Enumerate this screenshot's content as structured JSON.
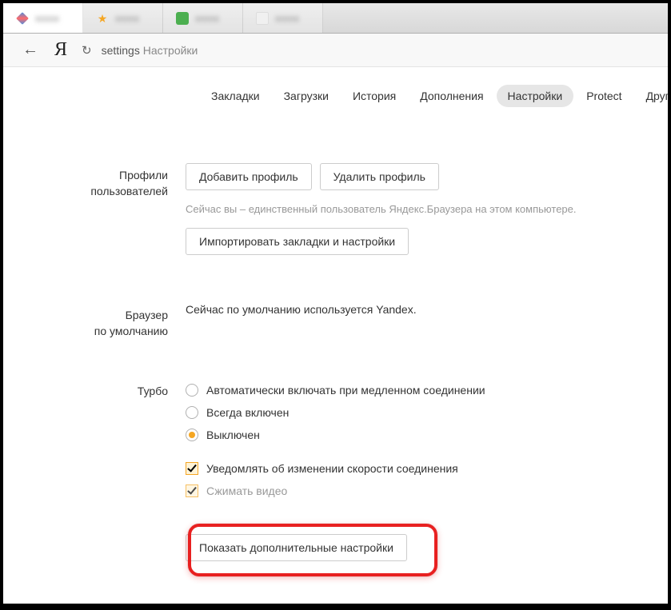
{
  "tabs": [
    {
      "title": "xxxxx"
    },
    {
      "title": "xxxxx"
    },
    {
      "title": "xxxxx"
    },
    {
      "title": "xxxxx"
    }
  ],
  "address": {
    "url_key": "settings",
    "url_rest": "Настройки"
  },
  "nav": {
    "items": [
      {
        "label": "Закладки",
        "active": false
      },
      {
        "label": "Загрузки",
        "active": false
      },
      {
        "label": "История",
        "active": false
      },
      {
        "label": "Дополнения",
        "active": false
      },
      {
        "label": "Настройки",
        "active": true
      },
      {
        "label": "Protect",
        "active": false
      },
      {
        "label": "Другие устро",
        "active": false
      }
    ]
  },
  "sections": {
    "profiles": {
      "title_l1": "Профили",
      "title_l2": "пользователей",
      "add_btn": "Добавить профиль",
      "del_btn": "Удалить профиль",
      "hint": "Сейчас вы – единственный пользователь Яндекс.Браузера на этом компьютере.",
      "import_btn": "Импортировать закладки и настройки"
    },
    "default_browser": {
      "title_l1": "Браузер",
      "title_l2": "по умолчанию",
      "text": "Сейчас по умолчанию используется Yandex."
    },
    "turbo": {
      "title": "Турбо",
      "opt_auto": "Автоматически включать при медленном соединении",
      "opt_always": "Всегда включен",
      "opt_off": "Выключен",
      "chk_notify": "Уведомлять об изменении скорости соединения",
      "chk_compress": "Сжимать видео"
    },
    "advanced": {
      "btn": "Показать дополнительные настройки"
    }
  }
}
